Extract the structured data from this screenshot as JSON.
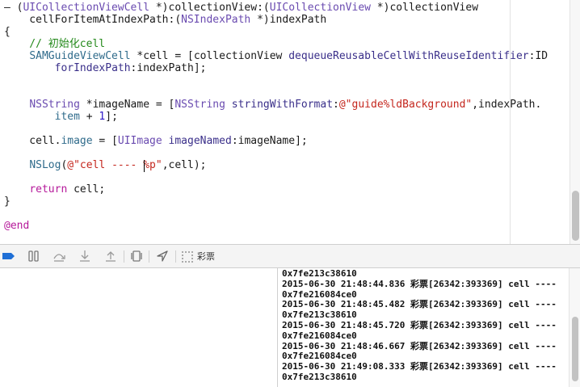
{
  "code_lines": [
    [
      {
        "t": "– (",
        "c": "plain"
      },
      {
        "t": "UICollectionViewCell",
        "c": "cls"
      },
      {
        "t": " *)collectionView:(",
        "c": "plain"
      },
      {
        "t": "UICollectionView",
        "c": "cls"
      },
      {
        "t": " *)collectionView",
        "c": "plain"
      }
    ],
    [
      {
        "t": "    cellForItemAtIndexPath:(",
        "c": "plain"
      },
      {
        "t": "NSIndexPath",
        "c": "cls"
      },
      {
        "t": " *)indexPath",
        "c": "plain"
      }
    ],
    [
      {
        "t": "{",
        "c": "plain"
      }
    ],
    [
      {
        "t": "    // 初始化cell",
        "c": "cm"
      }
    ],
    [
      {
        "t": "    ",
        "c": "plain"
      },
      {
        "t": "SAMGuideViewCell",
        "c": "prop"
      },
      {
        "t": " *cell = [collectionView ",
        "c": "plain"
      },
      {
        "t": "dequeueReusableCellWithReuseIdentifier",
        "c": "mtd"
      },
      {
        "t": ":ID",
        "c": "plain"
      }
    ],
    [
      {
        "t": "        ",
        "c": "plain"
      },
      {
        "t": "forIndexPath",
        "c": "mtd"
      },
      {
        "t": ":indexPath];",
        "c": "plain"
      }
    ],
    [],
    [],
    [
      {
        "t": "    ",
        "c": "plain"
      },
      {
        "t": "NSString",
        "c": "cls"
      },
      {
        "t": " *imageName = [",
        "c": "plain"
      },
      {
        "t": "NSString",
        "c": "cls"
      },
      {
        "t": " ",
        "c": "plain"
      },
      {
        "t": "stringWithFormat",
        "c": "mtd"
      },
      {
        "t": ":",
        "c": "plain"
      },
      {
        "t": "@\"guide%ldBackground\"",
        "c": "str"
      },
      {
        "t": ",indexPath.",
        "c": "plain"
      }
    ],
    [
      {
        "t": "        ",
        "c": "plain"
      },
      {
        "t": "item",
        "c": "prop"
      },
      {
        "t": " + ",
        "c": "plain"
      },
      {
        "t": "1",
        "c": "num"
      },
      {
        "t": "];",
        "c": "plain"
      }
    ],
    [],
    [
      {
        "t": "    cell.",
        "c": "plain"
      },
      {
        "t": "image",
        "c": "prop"
      },
      {
        "t": " = [",
        "c": "plain"
      },
      {
        "t": "UIImage",
        "c": "cls"
      },
      {
        "t": " ",
        "c": "plain"
      },
      {
        "t": "imageNamed",
        "c": "mtd"
      },
      {
        "t": ":imageName];",
        "c": "plain"
      }
    ],
    [],
    [
      {
        "t": "    ",
        "c": "plain"
      },
      {
        "t": "NSLog",
        "c": "prop"
      },
      {
        "t": "(",
        "c": "plain"
      },
      {
        "t": "@\"cell ---- %p\"",
        "c": "str"
      },
      {
        "t": ",cell);",
        "c": "plain"
      }
    ],
    [],
    [
      {
        "t": "    ",
        "c": "plain"
      },
      {
        "t": "return",
        "c": "kw"
      },
      {
        "t": " cell;",
        "c": "plain"
      }
    ],
    [
      {
        "t": "}",
        "c": "plain"
      }
    ],
    [],
    [
      {
        "t": "@end",
        "c": "kw"
      }
    ]
  ],
  "debug_bar": {
    "thread_label": "彩票",
    "icons": [
      "breakpoints-toggle-icon",
      "pause-icon",
      "step-over-icon",
      "step-into-icon",
      "step-out-icon",
      "view-hierarchy-icon",
      "location-icon",
      "thread-icon"
    ]
  },
  "console_lines": [
    "0x7fe213c38610",
    "2015-06-30 21:48:44.836 彩票[26342:393369] cell ----",
    "0x7fe216084ce0",
    "2015-06-30 21:48:45.482 彩票[26342:393369] cell ----",
    "0x7fe213c38610",
    "2015-06-30 21:48:45.720 彩票[26342:393369] cell ----",
    "0x7fe216084ce0",
    "2015-06-30 21:48:46.667 彩票[26342:393369] cell ----",
    "0x7fe216084ce0",
    "2015-06-30 21:49:08.333 彩票[26342:393369] cell ----",
    "0x7fe213c38610"
  ],
  "colors": {
    "keyword": "#b5199a",
    "class": "#6a4bb0",
    "comment": "#23891a",
    "string": "#c4261d",
    "number": "#2d18c7",
    "breakpoint_active": "#1f6fd6"
  }
}
